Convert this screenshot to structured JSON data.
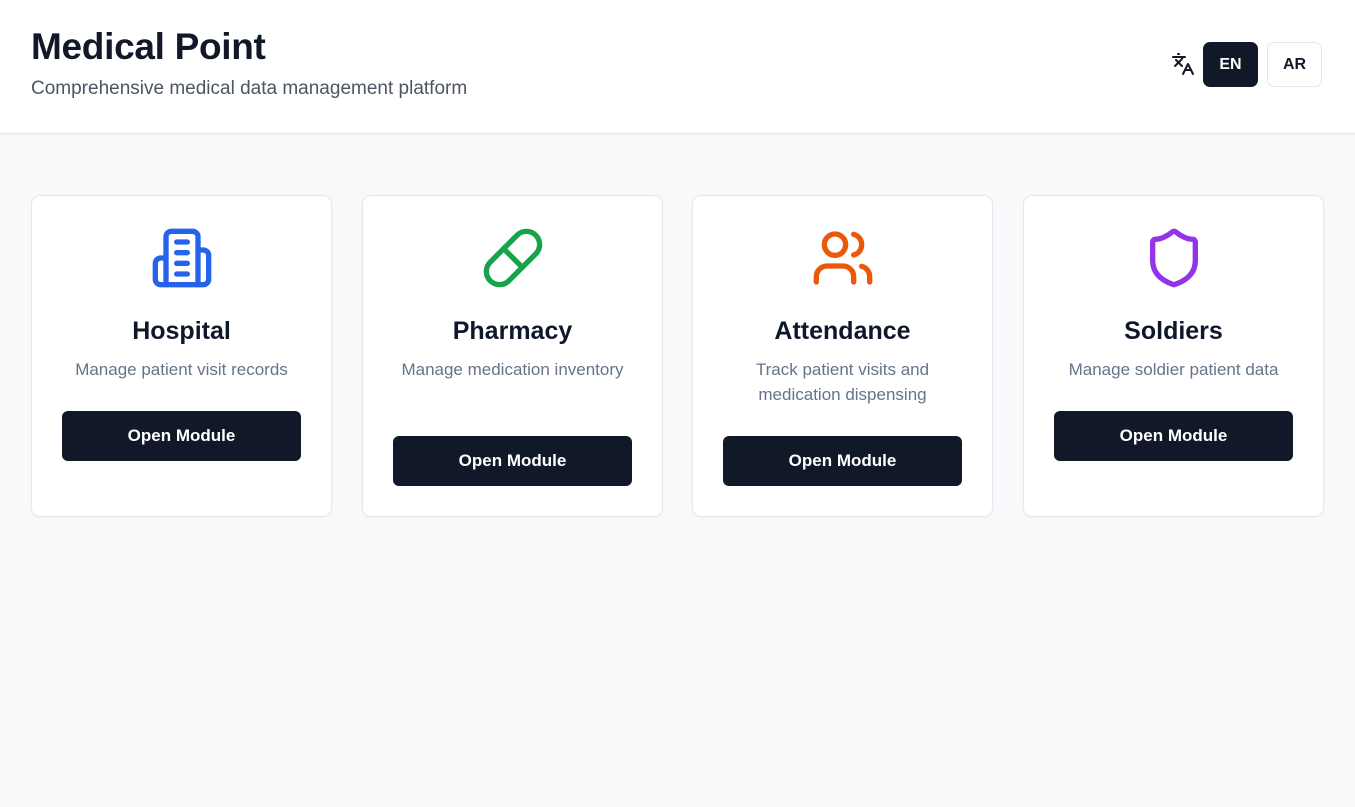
{
  "header": {
    "title": "Medical Point",
    "subtitle": "Comprehensive medical data management platform",
    "language_icon": "translate-icon",
    "languages": [
      {
        "label": "EN",
        "active": true
      },
      {
        "label": "AR",
        "active": false
      }
    ]
  },
  "modules": [
    {
      "icon": "building-icon",
      "icon_color": "#2563eb",
      "title": "Hospital",
      "description": "Manage patient visit records",
      "button_label": "Open Module"
    },
    {
      "icon": "pill-icon",
      "icon_color": "#16a34a",
      "title": "Pharmacy",
      "description": "Manage medication inventory",
      "button_label": "Open Module"
    },
    {
      "icon": "users-icon",
      "icon_color": "#ea580c",
      "title": "Attendance",
      "description": "Track patient visits and medication dispensing",
      "button_label": "Open Module"
    },
    {
      "icon": "shield-icon",
      "icon_color": "#9333ea",
      "title": "Soldiers",
      "description": "Manage soldier patient data",
      "button_label": "Open Module"
    }
  ],
  "colors": {
    "primary": "#111827",
    "background": "#f8f9fb",
    "muted_text": "#64748b"
  }
}
